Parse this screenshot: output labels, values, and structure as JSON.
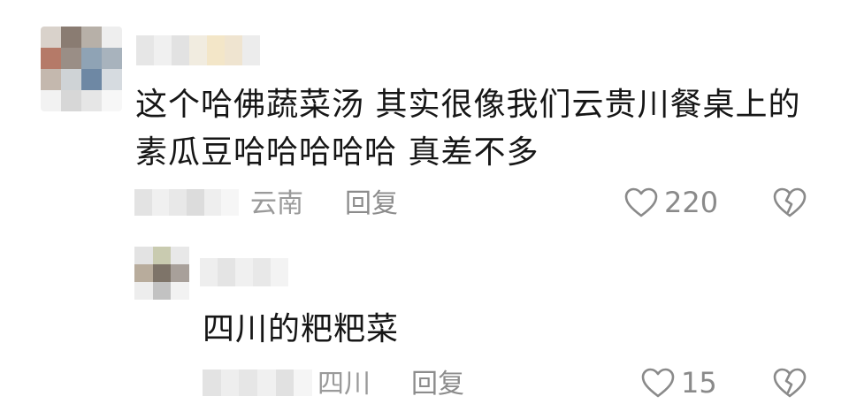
{
  "comment": {
    "text": "这个哈佛蔬菜汤 其实很像我们云贵川餐桌上的素瓜豆哈哈哈哈哈 真差不多",
    "location": "云南",
    "reply_label": "回复",
    "likes": "220",
    "avatar_icon": "blurred-avatar",
    "like_icon": "heart-outline-icon",
    "dislike_icon": "broken-heart-icon"
  },
  "reply": {
    "text": "四川的粑粑菜",
    "location": "四川",
    "reply_label": "回复",
    "likes": "15",
    "avatar_icon": "blurred-avatar",
    "like_icon": "heart-outline-icon",
    "dislike_icon": "broken-heart-icon"
  },
  "colors": {
    "text": "#161616",
    "meta": "#9a9a9a",
    "icon": "#8a8a8a"
  }
}
